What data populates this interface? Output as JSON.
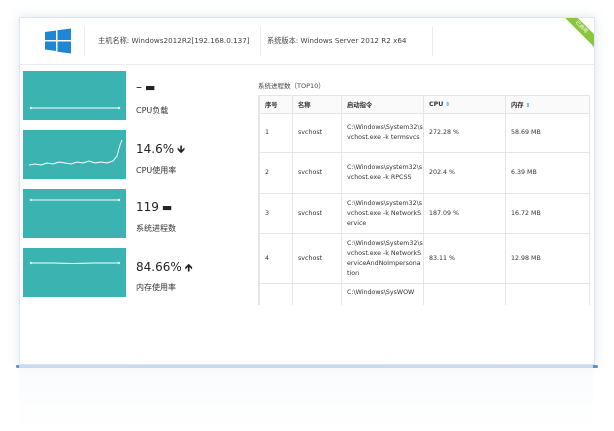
{
  "header": {
    "hostname": "主机名称: Windows2012R2[192.168.0.137]",
    "os_version": "系统版本: Windows Server 2012 R2 x64",
    "status_badge": "已启用"
  },
  "colors": {
    "tile": "#3bb3b0",
    "badge": "#8cc63f",
    "sort": "#3a9ad9"
  },
  "metrics": [
    {
      "value": "–",
      "trend": "▬",
      "label": "CPU负载"
    },
    {
      "value": "14.6%",
      "trend": "🡻",
      "label": "CPU使用率"
    },
    {
      "value": "119",
      "trend": "▬",
      "label": "系统进程数"
    },
    {
      "value": "84.66%",
      "trend": "🡹",
      "label": "内存使用率"
    }
  ],
  "table": {
    "title": "系统进程数（TOP10）",
    "headers": {
      "index": "序号",
      "name": "名称",
      "cmd": "启动指令",
      "cpu": "CPU",
      "mem": "内存"
    },
    "rows": [
      {
        "index": "1",
        "name": "svchost",
        "cmd": "C:\\Windows\\System32\\svchost.exe -k termsvcs",
        "cpu": "272.28 %",
        "mem": "58.69 MB"
      },
      {
        "index": "2",
        "name": "svchost",
        "cmd": "C:\\Windows\\system32\\svchost.exe -k RPCSS",
        "cpu": "202.4 %",
        "mem": "6.39 MB"
      },
      {
        "index": "3",
        "name": "svchost",
        "cmd": "C:\\Windows\\system32\\svchost.exe -k NetworkService",
        "cpu": "187.09 %",
        "mem": "16.72 MB"
      },
      {
        "index": "4",
        "name": "svchost",
        "cmd": "C:\\Windows\\System32\\svchost.exe -k NetworkServiceAndNoImpersonation",
        "cpu": "83.11 %",
        "mem": "12.98 MB"
      },
      {
        "index": "",
        "name": "",
        "cmd": "C:\\Windows\\SysWOW",
        "cpu": "",
        "mem": ""
      }
    ]
  }
}
